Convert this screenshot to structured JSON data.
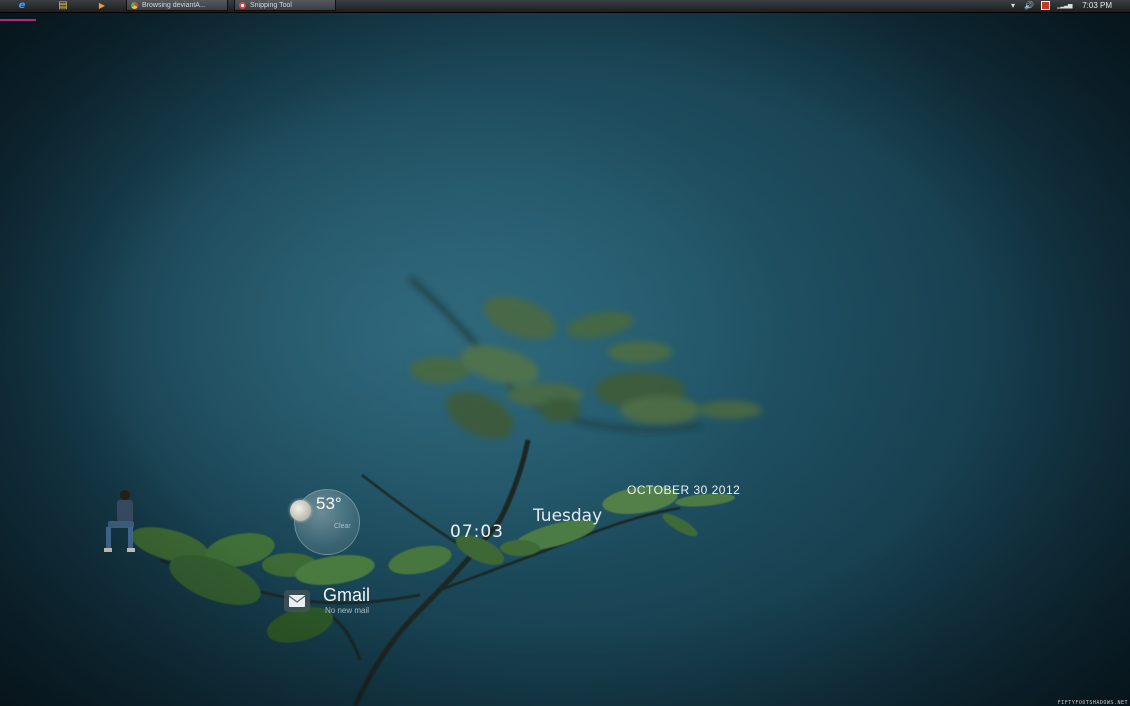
{
  "taskbar": {
    "pinned": [
      {
        "name": "ie-icon",
        "glyph": "e",
        "color": "#3aa0ff"
      },
      {
        "name": "explorer-icon",
        "glyph": "▤",
        "color": "#e8c45a"
      },
      {
        "name": "media-player-icon",
        "glyph": "▶",
        "color": "#f29a2e"
      }
    ],
    "tasks": [
      {
        "label": "Browsing deviantA...",
        "icon": "chrome-icon",
        "color": "#4caf50"
      },
      {
        "label": "Snipping Tool",
        "icon": "snipping-tool-icon",
        "color": "#e04040"
      }
    ],
    "tray": {
      "time": "7:03 PM",
      "icons": [
        "chevron-up-icon",
        "volume-icon",
        "action-center-icon",
        "network-signal-icon"
      ]
    }
  },
  "widgets": {
    "date": "OCTOBER 30 2012",
    "day": "Tuesday",
    "time": "07:03",
    "weather": {
      "temp": "53°",
      "condition": "Clear",
      "icon": "moon-icon"
    },
    "mail": {
      "title": "Gmail",
      "status": "No new mail",
      "icon": "mail-icon"
    }
  },
  "watermark": "FIFTYFOOTSHADOWS.NET",
  "colors": {
    "background": "#1e5566",
    "taskbar": "#2a2d30",
    "accent": "#b0287a"
  }
}
